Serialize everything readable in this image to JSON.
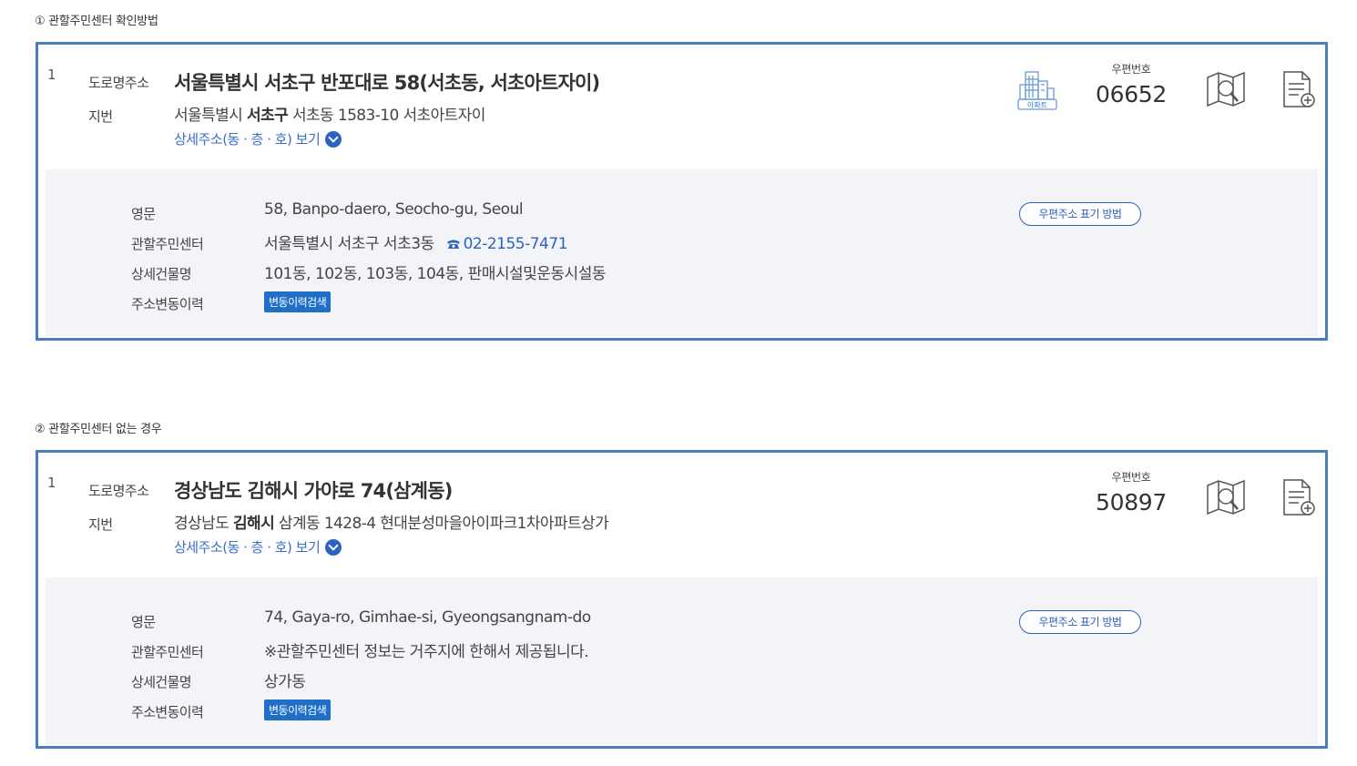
{
  "sections": [
    {
      "title": "① 관할주민센터 확인방법",
      "card": {
        "index": "1",
        "road_label": "도로명주소",
        "road_value": "서울특별시 서초구 반포대로 58(서초동, 서초아트자이)",
        "jibun_label": "지번",
        "jibun_prefix": "서울특별시",
        "jibun_bold": "서초구",
        "jibun_rest": "서초동 1583-10 서초아트자이",
        "detail_link": "상세주소(동 · 층 · 호) 보기",
        "apt_icon_label": "아파트",
        "zip_label": "우편번호",
        "zip_value": "06652",
        "english_label": "영문",
        "english_value": "58, Banpo-daero, Seocho-gu, Seoul",
        "center_label": "관할주민센터",
        "center_value": "서울특별시 서초구 서초3동",
        "center_phone": "02-2155-7471",
        "building_label": "상세건물명",
        "building_value": "101동, 102동, 103동, 104동, 판매시설및운동시설동",
        "history_label": "주소변동이력",
        "history_button": "변동이력검색",
        "zip_guide_button": "우편주소 표기 방법"
      }
    },
    {
      "title": "② 관할주민센터 없는 경우",
      "card": {
        "index": "1",
        "road_label": "도로명주소",
        "road_value": "경상남도 김해시 가야로 74(삼계동)",
        "jibun_label": "지번",
        "jibun_prefix": "경상남도",
        "jibun_bold": "김해시",
        "jibun_rest": "삼계동 1428-4 현대분성마을아이파크1차아파트상가",
        "detail_link": "상세주소(동 · 층 · 호) 보기",
        "zip_label": "우편번호",
        "zip_value": "50897",
        "english_label": "영문",
        "english_value": "74, Gaya-ro, Gimhae-si, Gyeongsangnam-do",
        "center_label": "관할주민센터",
        "center_value": "※관할주민센터 정보는 거주지에 한해서 제공됩니다.",
        "building_label": "상세건물명",
        "building_value": "상가동",
        "history_label": "주소변동이력",
        "history_button": "변동이력검색",
        "zip_guide_button": "우편주소 표기 방법"
      }
    }
  ],
  "colors": {
    "card_border": "#4a7cc0",
    "link": "#3a6fc4",
    "button_blue": "#1f6fc8",
    "detail_bg": "#f2f4f7"
  },
  "icons": [
    "apartment-icon",
    "map-search-icon",
    "document-add-icon",
    "phone-icon",
    "chevron-down-icon"
  ]
}
